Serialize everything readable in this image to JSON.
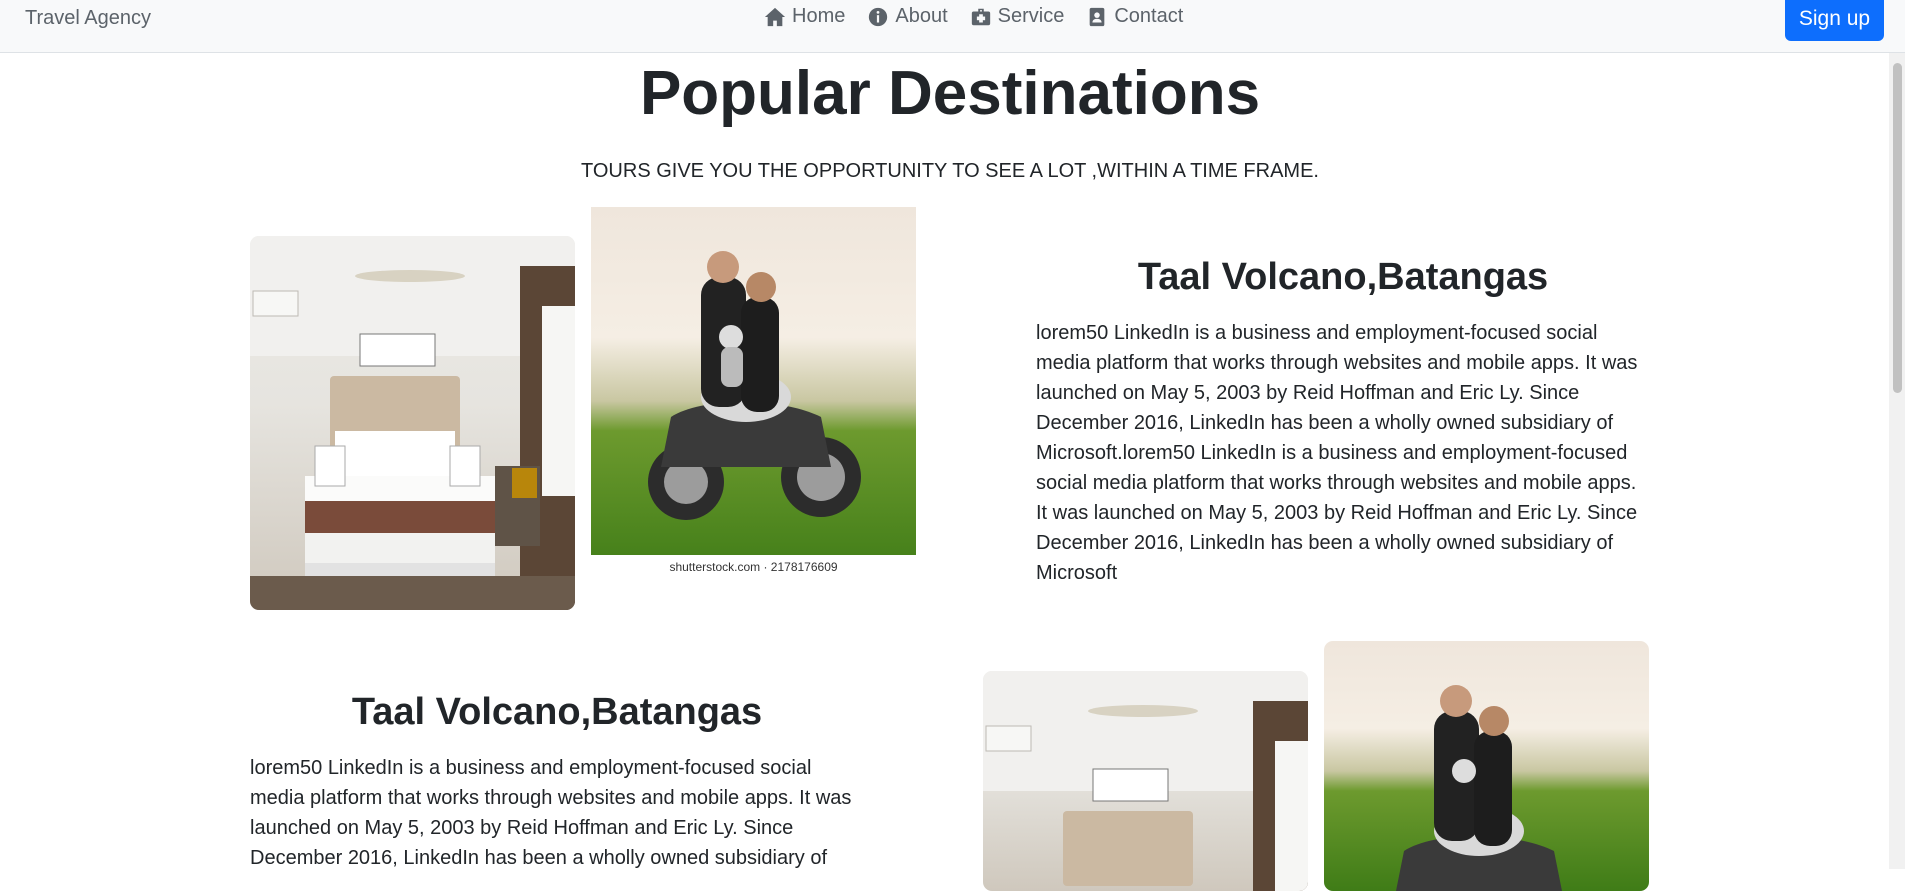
{
  "nav": {
    "brand": "Travel Agency",
    "links": [
      {
        "label": "Home",
        "icon": "home-icon"
      },
      {
        "label": "About",
        "icon": "info-icon"
      },
      {
        "label": "Service",
        "icon": "suitcase-icon"
      },
      {
        "label": "Contact",
        "icon": "contact-icon"
      }
    ],
    "signup": "Sign up"
  },
  "page": {
    "title": "Popular Destinations",
    "subtitle": "TOURS GIVE YOU THE OPPORTUNITY TO SEE A LOT ,WITHIN A TIME FRAME."
  },
  "destinations": [
    {
      "title": "Taal Volcano,Batangas",
      "text": "lorem50 LinkedIn is a business and employment-focused social media platform that works through websites and mobile apps. It was launched on May 5, 2003 by Reid Hoffman and Eric Ly. Since December 2016, LinkedIn has been a wholly owned subsidiary of Microsoft.lorem50 LinkedIn is a business and employment-focused social media platform that works through websites and mobile apps. It was launched on May 5, 2003 by Reid Hoffman and Eric Ly. Since December 2016, LinkedIn has been a wholly owned subsidiary of Microsoft",
      "image_credit": "shutterstock.com · 2178176609"
    },
    {
      "title": "Taal Volcano,Batangas",
      "text": "lorem50 LinkedIn is a business and employment-focused social media platform that works through websites and mobile apps. It was launched on May 5, 2003 by Reid Hoffman and Eric Ly. Since December 2016, LinkedIn has been a wholly owned subsidiary of"
    }
  ],
  "colors": {
    "primary": "#0d6efd",
    "navbar": "#f8f9fa",
    "text": "#212529"
  }
}
